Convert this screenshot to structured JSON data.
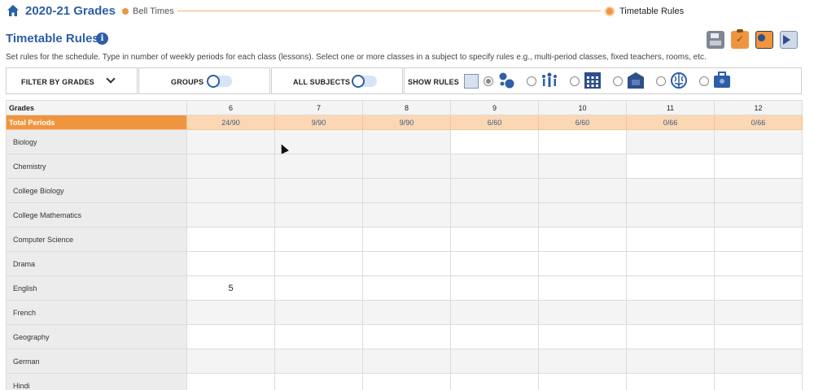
{
  "header": {
    "title": "2020-21 Grades",
    "steps": [
      {
        "label": "Bell Times"
      },
      {
        "label": "Timetable Rules"
      }
    ]
  },
  "page": {
    "title": "Timetable Rules",
    "info_icon": "i",
    "description": "Set rules for the schedule. Type in number of weekly periods for each class (lessons). Select one or more classes in a subject to specify rules e.g., multi-period classes, fixed teachers, rooms, etc."
  },
  "toolbar": {
    "icons": [
      "save-icon",
      "clipboard-check-icon",
      "grid-icon",
      "play-icon"
    ]
  },
  "filters": {
    "filter_by_grades": "FILTER BY GRADES",
    "groups": "GROUPS",
    "all_subjects": "ALL SUBJECTS",
    "show_rules": "SHOW RULES",
    "rule_icons": [
      "balls-icon",
      "people-icon",
      "calendar-icon",
      "room-icon",
      "brain-icon",
      "kit-icon"
    ]
  },
  "table": {
    "grades_header": "Grades",
    "grades": [
      "6",
      "7",
      "8",
      "9",
      "10",
      "11",
      "12"
    ],
    "total_label": "Total Periods",
    "totals": [
      "24/90",
      "9/90",
      "9/90",
      "6/60",
      "6/60",
      "0/66",
      "0/66"
    ],
    "rows": [
      {
        "subject": "Biology",
        "values": [
          "",
          "",
          "",
          "",
          "",
          "",
          ""
        ]
      },
      {
        "subject": "Chemistry",
        "values": [
          "",
          "",
          "",
          "",
          "",
          "",
          ""
        ]
      },
      {
        "subject": "College Biology",
        "values": [
          "",
          "",
          "",
          "",
          "",
          "",
          ""
        ]
      },
      {
        "subject": "College Mathematics",
        "values": [
          "",
          "",
          "",
          "",
          "",
          "",
          ""
        ]
      },
      {
        "subject": "Computer Science",
        "values": [
          "",
          "",
          "",
          "",
          "",
          "",
          ""
        ]
      },
      {
        "subject": "Drama",
        "values": [
          "",
          "",
          "",
          "",
          "",
          "",
          ""
        ]
      },
      {
        "subject": "English",
        "values": [
          "5",
          "",
          "",
          "",
          "",
          "",
          ""
        ]
      },
      {
        "subject": "French",
        "values": [
          "",
          "",
          "",
          "",
          "",
          "",
          ""
        ]
      },
      {
        "subject": "Geography",
        "values": [
          "",
          "",
          "",
          "",
          "",
          "",
          ""
        ]
      },
      {
        "subject": "German",
        "values": [
          "",
          "",
          "",
          "",
          "",
          "",
          ""
        ]
      },
      {
        "subject": "Hindi",
        "values": [
          "",
          "",
          "",
          "",
          "",
          "",
          ""
        ]
      }
    ]
  },
  "colors": {
    "accent": "#2d5ea8",
    "orange": "#f0953f",
    "total_row": "#fcd7b4"
  }
}
